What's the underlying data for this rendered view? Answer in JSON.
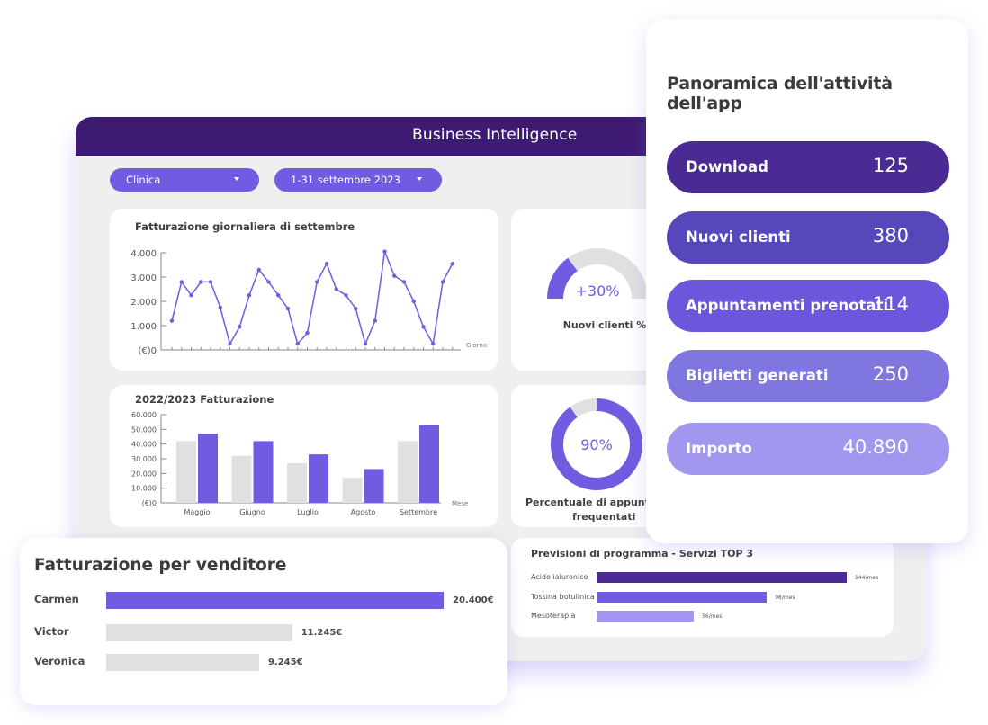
{
  "app": {
    "title": "Business Intelligence",
    "filters": {
      "location": "Clinica",
      "period": "1-31 settembre 2023"
    }
  },
  "colors": {
    "header": "#3e1b73",
    "accent": "#6f5ce0",
    "light_gray": "#e0e0e0"
  },
  "daily_revenue": {
    "title": "Fatturazione giornaliera di settembre"
  },
  "yearly_revenue": {
    "title": "2022/2023 Fatturazione"
  },
  "new_clients_gauge": {
    "value_label": "+30%",
    "fraction": 0.3,
    "caption": "Nuovi clienti %"
  },
  "appointments_donut": {
    "value_label": "90%",
    "fraction": 0.9,
    "caption_line1": "Percentuale di appuntamenti",
    "caption_line2": "frequentati"
  },
  "overview": {
    "title": "Panoramica dell'attività dell'app",
    "items": [
      {
        "label": "Download",
        "value": "125",
        "color": "#4b2a94"
      },
      {
        "label": "Nuovi clienti",
        "value": "380",
        "color": "#5648bb"
      },
      {
        "label": "Appuntamenti prenotati",
        "value": "114",
        "color": "#6a57dc"
      },
      {
        "label": "Biglietti generati",
        "value": "250",
        "color": "#7f76df"
      },
      {
        "label": "Importo",
        "value": "40.890",
        "color": "#a197ef"
      }
    ]
  },
  "vendors": {
    "title": "Fatturazione per venditore",
    "items": [
      {
        "name": "Carmen",
        "value": 20400,
        "value_label": "20.400€",
        "color": "#6f5ce0"
      },
      {
        "name": "Victor",
        "value": 11245,
        "value_label": "11.245€",
        "color": "#e0e0e0"
      },
      {
        "name": "Veronica",
        "value": 9245,
        "value_label": "9.245€",
        "color": "#e0e0e0"
      }
    ]
  },
  "services": {
    "title": "Previsioni di programma - Servizi TOP 3",
    "items": [
      {
        "name": "Acido ialuronico",
        "value": 144,
        "value_label": "144/mes",
        "color": "#4b2a94"
      },
      {
        "name": "Tossina botulinica",
        "value": 98,
        "value_label": "98/mes",
        "color": "#6f5ce0"
      },
      {
        "name": "Mesoterapia",
        "value": 56,
        "value_label": "56/mes",
        "color": "#a197ef"
      }
    ]
  },
  "chart_data": [
    {
      "type": "line",
      "title": "Fatturazione giornaliera di settembre",
      "xlabel": "Giorno",
      "ylabel": "(€)",
      "x": [
        1,
        2,
        3,
        4,
        5,
        6,
        7,
        8,
        9,
        10,
        11,
        12,
        13,
        14,
        15,
        16,
        17,
        18,
        19,
        20,
        21,
        22,
        23,
        24,
        25,
        26,
        27,
        28,
        29,
        30
      ],
      "values": [
        1200,
        2800,
        2250,
        2800,
        2800,
        1750,
        250,
        950,
        2250,
        3300,
        2800,
        2250,
        1700,
        250,
        700,
        2800,
        3550,
        2500,
        2250,
        1700,
        250,
        1200,
        4050,
        3050,
        2800,
        2000,
        950,
        250,
        2800,
        3550
      ],
      "yticks": [
        "(€)0",
        "1.000",
        "2.000",
        "3.000",
        "4.000"
      ],
      "ylim": [
        0,
        4000
      ],
      "color": "#6f5ce0",
      "grid": false
    },
    {
      "type": "bar",
      "title": "2022/2023 Fatturazione",
      "xlabel": "Mese",
      "ylabel": "(€)",
      "categories": [
        "Maggio",
        "Giugno",
        "Luglio",
        "Agosto",
        "Settembre"
      ],
      "series": [
        {
          "name": "2022",
          "values": [
            42000,
            32000,
            27000,
            17000,
            42000
          ],
          "color": "#e0e0e0"
        },
        {
          "name": "2023",
          "values": [
            47000,
            42000,
            33000,
            23000,
            53000
          ],
          "color": "#6f5ce0"
        }
      ],
      "yticks": [
        "(€)0",
        "10.000",
        "20.000",
        "30.000",
        "40.000",
        "50.000",
        "60.000"
      ],
      "ylim": [
        0,
        60000
      ],
      "grid": false
    },
    {
      "type": "bar",
      "title": "Fatturazione per venditore",
      "orientation": "horizontal",
      "categories": [
        "Carmen",
        "Victor",
        "Veronica"
      ],
      "values": [
        20400,
        11245,
        9245
      ]
    },
    {
      "type": "bar",
      "title": "Previsioni di programma - Servizi TOP 3",
      "orientation": "horizontal",
      "categories": [
        "Acido ialuronico",
        "Tossina botulinica",
        "Mesoterapia"
      ],
      "values": [
        144,
        98,
        56
      ],
      "unit": "/mes"
    }
  ]
}
